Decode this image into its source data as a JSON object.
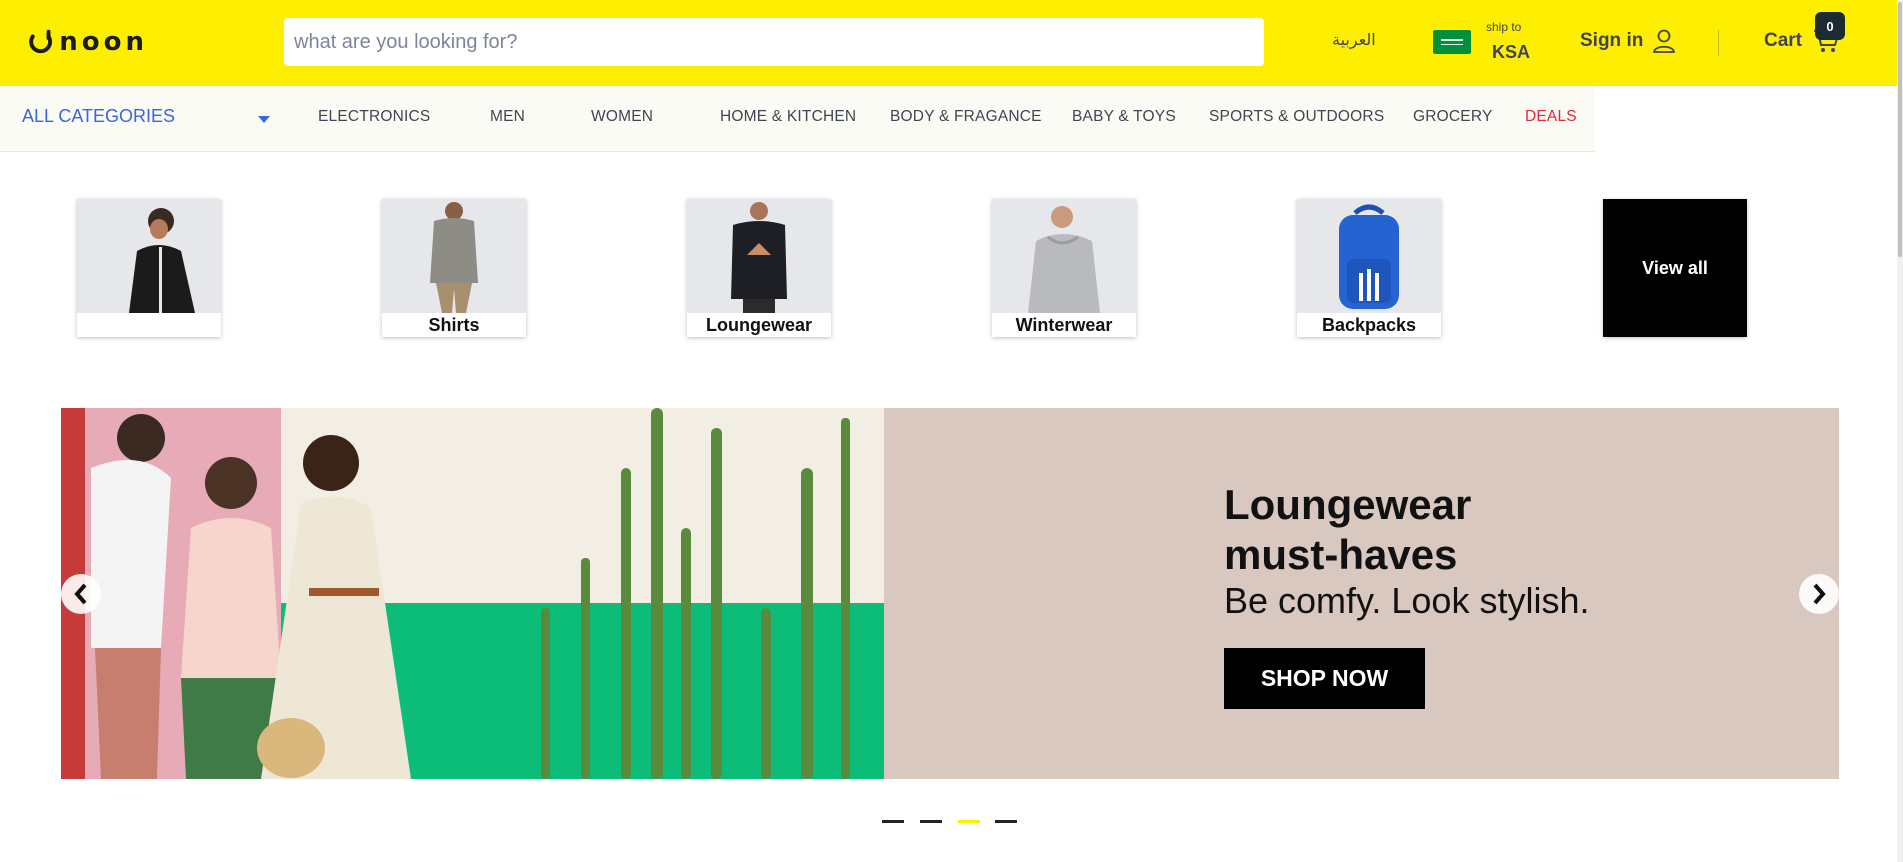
{
  "header": {
    "logo_text": "noon",
    "search_placeholder": "what are you looking for?",
    "language": "العربية",
    "ship_to_label": "ship to",
    "ship_country": "KSA",
    "sign_in": "Sign in",
    "cart_label": "Cart",
    "cart_count": "0",
    "brand_color": "#feee00"
  },
  "nav": {
    "all_categories": "ALL CATEGORIES",
    "items": [
      {
        "label": "ELECTRONICS"
      },
      {
        "label": "MEN"
      },
      {
        "label": "WOMEN"
      },
      {
        "label": "HOME & KITCHEN"
      },
      {
        "label": "BODY & FRAGANCE"
      },
      {
        "label": "BABY & TOYS"
      },
      {
        "label": "SPORTS & OUTDOORS"
      },
      {
        "label": "GROCERY"
      },
      {
        "label": "DEALS"
      }
    ],
    "deals_color": "#e0263b"
  },
  "categories": [
    {
      "label": ""
    },
    {
      "label": "Shirts"
    },
    {
      "label": "Loungewear"
    },
    {
      "label": "Winterwear"
    },
    {
      "label": "Backpacks"
    },
    {
      "label": "View all"
    }
  ],
  "banner": {
    "title_line1": "Loungewear",
    "title_line2": "must-haves",
    "subtitle": "Be comfy. Look stylish.",
    "cta": "SHOP NOW",
    "background_color": "#d9c8c0",
    "slides_total": 4,
    "active_slide": 3
  }
}
